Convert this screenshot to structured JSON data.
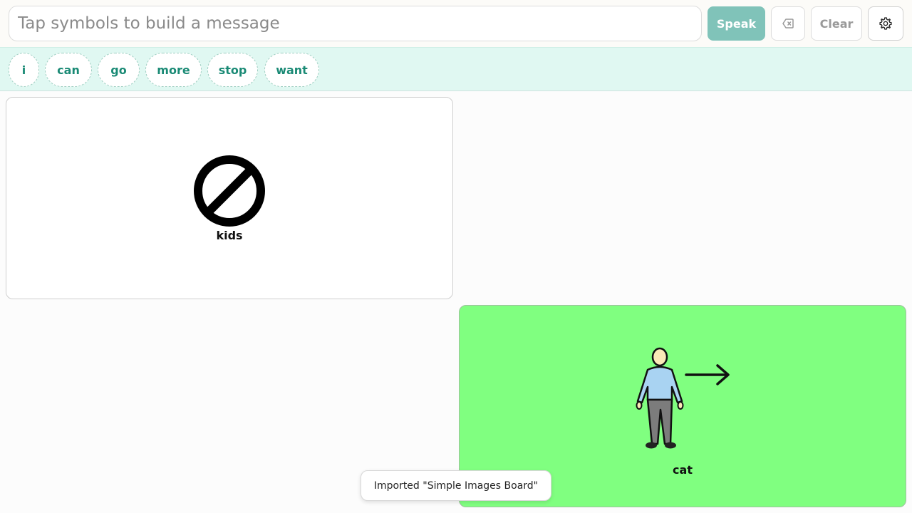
{
  "message_bar": {
    "placeholder": "Tap symbols to build a message",
    "speak_label": "Speak",
    "clear_label": "Clear",
    "backspace_icon": "backspace-icon",
    "settings_icon": "gear-icon"
  },
  "suggestions": [
    "i",
    "can",
    "go",
    "more",
    "stop",
    "want"
  ],
  "tiles": [
    {
      "label": "kids",
      "icon": "prohibited-icon",
      "background": "#ffffff"
    },
    {
      "label": "cat",
      "icon": "person-go-icon",
      "background": "#80ff80"
    }
  ],
  "toast": {
    "text": "Imported \"Simple Images Board\""
  },
  "colors": {
    "accent": "#80c3b9",
    "suggestion_bg": "#e0f8f2",
    "chip_text": "#1a8a75"
  }
}
